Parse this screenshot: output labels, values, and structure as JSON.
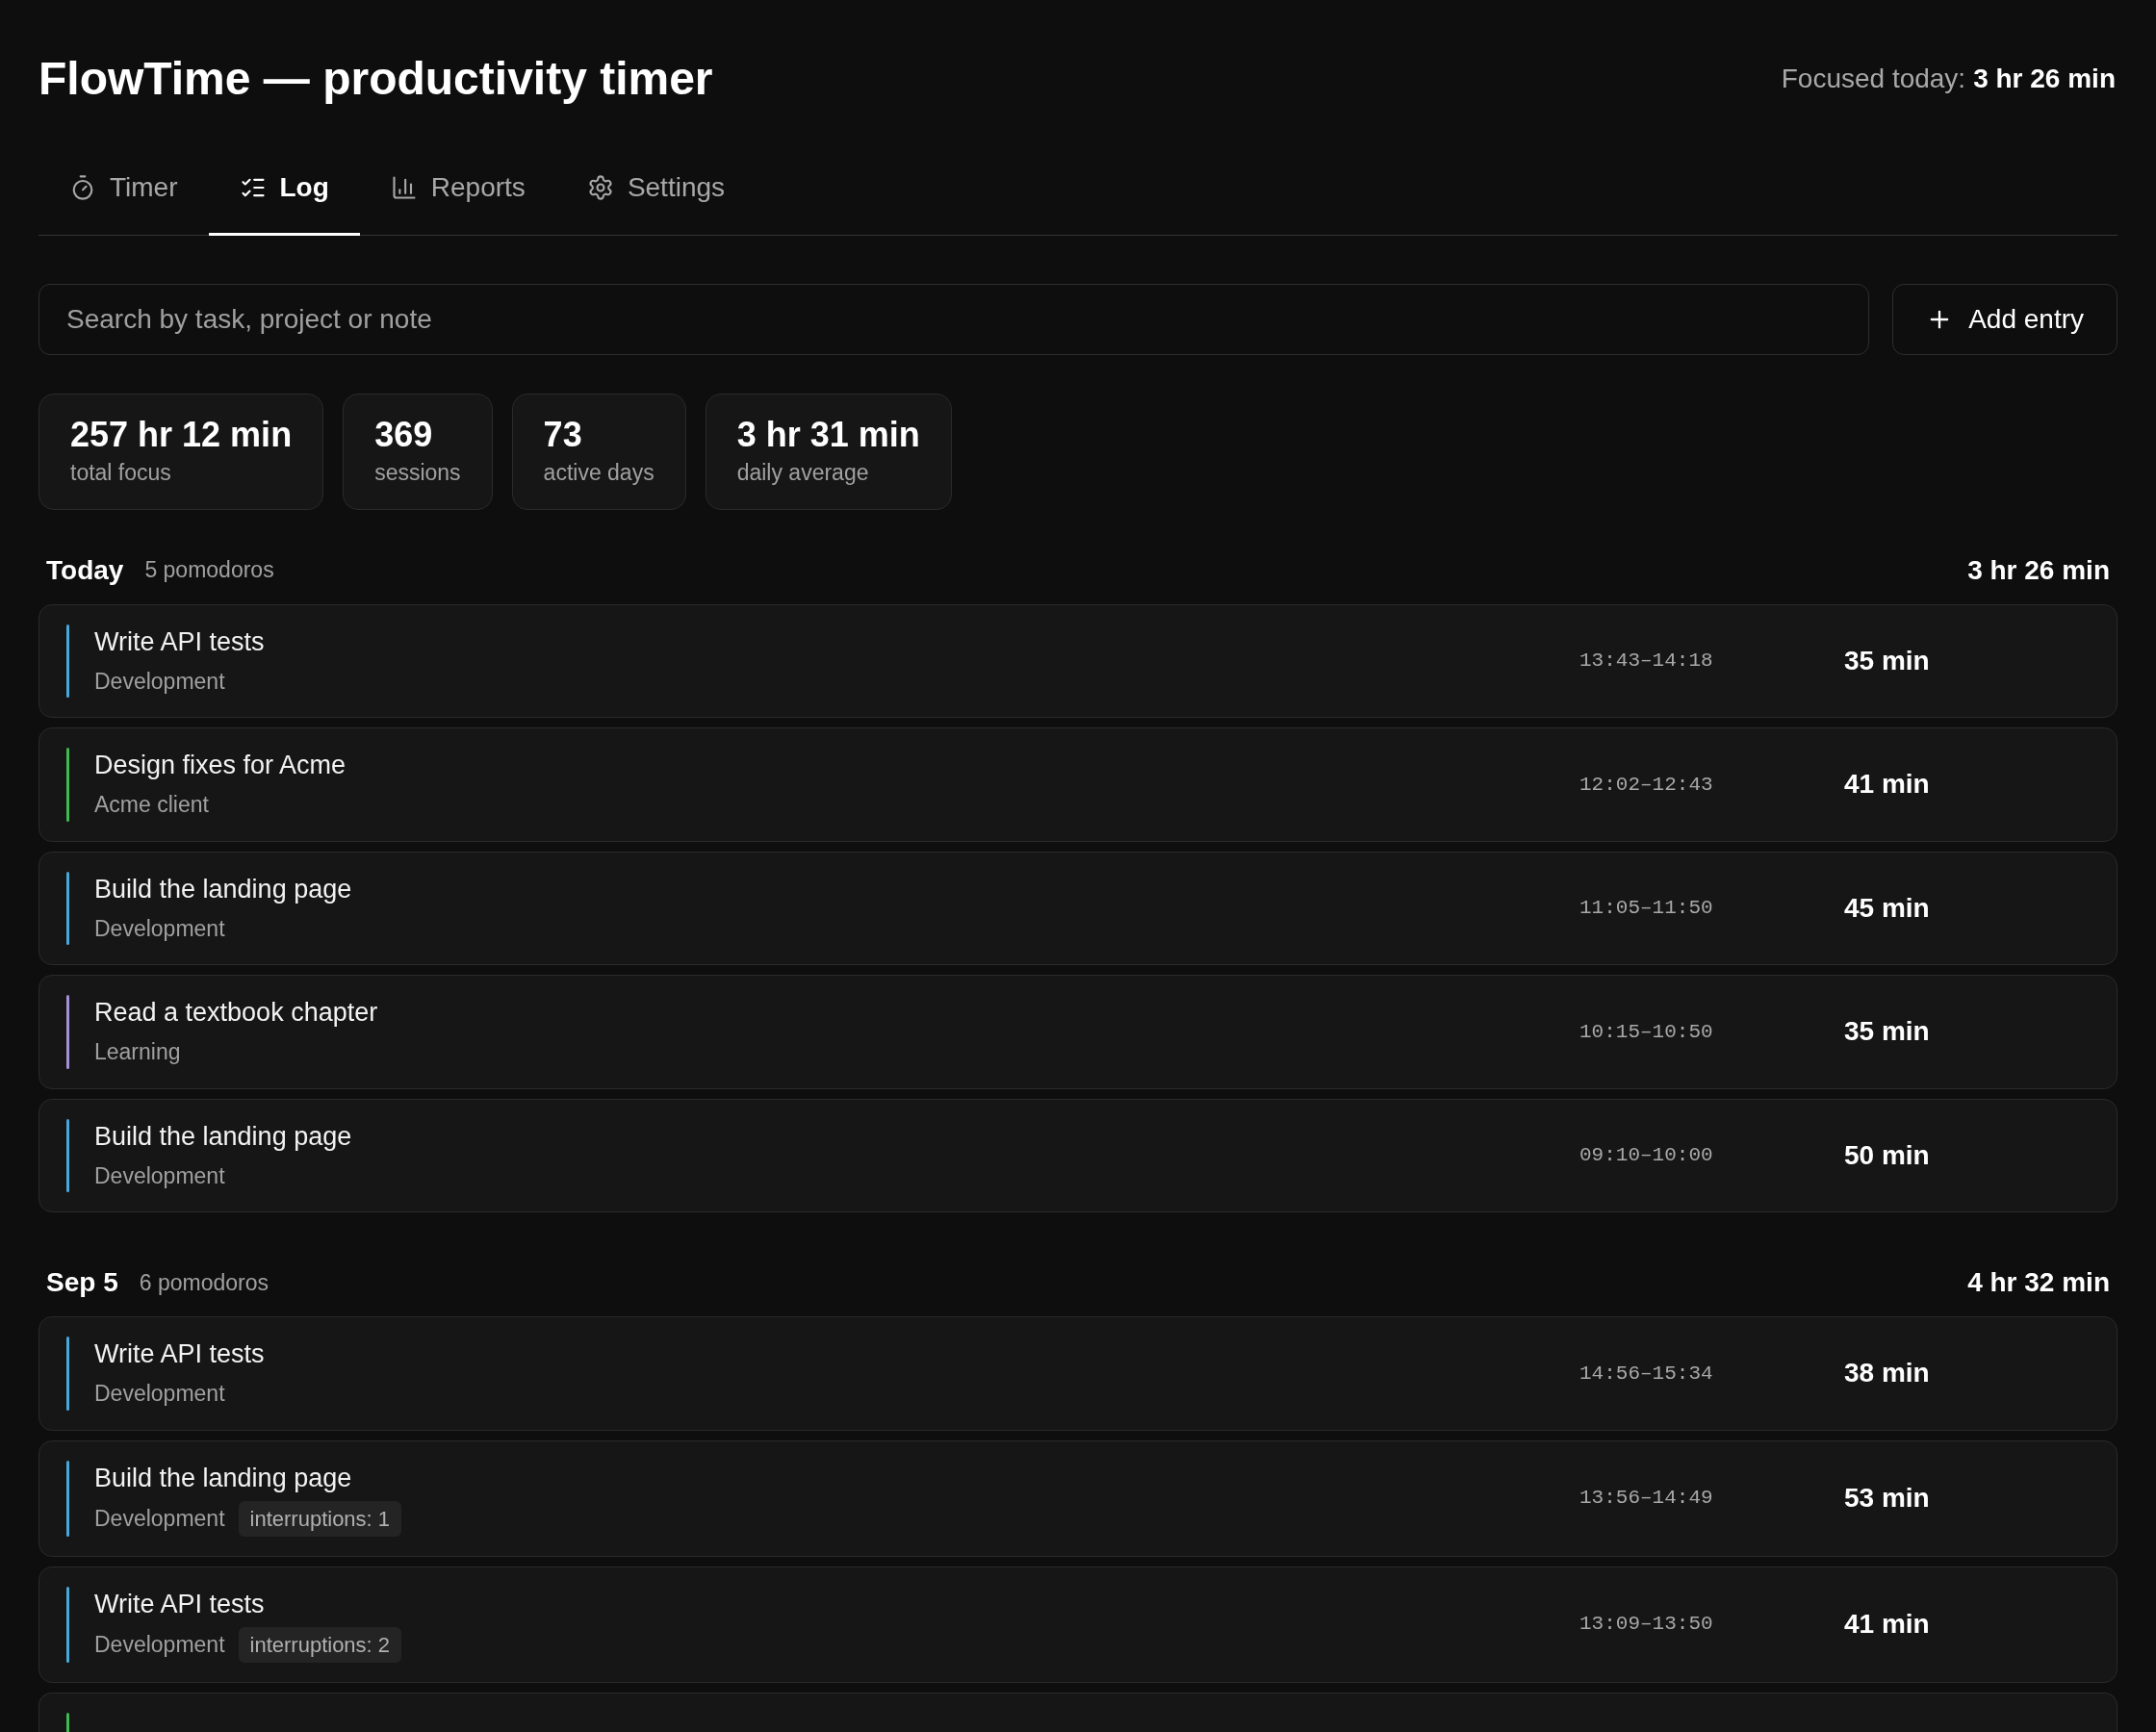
{
  "app": {
    "title": "FlowTime — productivity timer",
    "focused_label": "Focused today:",
    "focused_value": "3 hr 26 min"
  },
  "tabs": [
    {
      "label": "Timer",
      "kind": "timer",
      "selected": false
    },
    {
      "label": "Log",
      "kind": "log",
      "selected": true
    },
    {
      "label": "Reports",
      "kind": "reports",
      "selected": false
    },
    {
      "label": "Settings",
      "kind": "settings",
      "selected": false
    }
  ],
  "search": {
    "placeholder": "Search by task, project or note"
  },
  "add_button": "Add entry",
  "stats": [
    {
      "value": "257 hr 12 min",
      "label": "total focus"
    },
    {
      "value": "369",
      "label": "sessions"
    },
    {
      "value": "73",
      "label": "active days"
    },
    {
      "value": "3 hr 31 min",
      "label": "daily average"
    }
  ],
  "days": [
    {
      "day": "Today",
      "count": "5 pomodoros",
      "total": "3 hr 26 min",
      "entries": [
        {
          "task": "Write API tests",
          "project": "Development",
          "color": "#4aa8d8",
          "time": "13:43–14:18",
          "duration": "35 min"
        },
        {
          "task": "Design fixes for Acme",
          "project": "Acme client",
          "color": "#3fb950",
          "time": "12:02–12:43",
          "duration": "41 min"
        },
        {
          "task": "Build the landing page",
          "project": "Development",
          "color": "#4aa8d8",
          "time": "11:05–11:50",
          "duration": "45 min"
        },
        {
          "task": "Read a textbook chapter",
          "project": "Learning",
          "color": "#a58fd6",
          "time": "10:15–10:50",
          "duration": "35 min"
        },
        {
          "task": "Build the landing page",
          "project": "Development",
          "color": "#4aa8d8",
          "time": "09:10–10:00",
          "duration": "50 min"
        }
      ]
    },
    {
      "day": "Sep 5",
      "count": "6 pomodoros",
      "total": "4 hr 32 min",
      "entries": [
        {
          "task": "Write API tests",
          "project": "Development",
          "color": "#4aa8d8",
          "time": "14:56–15:34",
          "duration": "38 min"
        },
        {
          "task": "Build the landing page",
          "project": "Development",
          "color": "#4aa8d8",
          "time": "13:56–14:49",
          "duration": "53 min",
          "interruptions": "interruptions: 1"
        },
        {
          "task": "Write API tests",
          "project": "Development",
          "color": "#4aa8d8",
          "time": "13:09–13:50",
          "duration": "41 min",
          "interruptions": "interruptions: 2"
        },
        {
          "kind": "cut",
          "color": "#3fb950"
        }
      ]
    }
  ]
}
